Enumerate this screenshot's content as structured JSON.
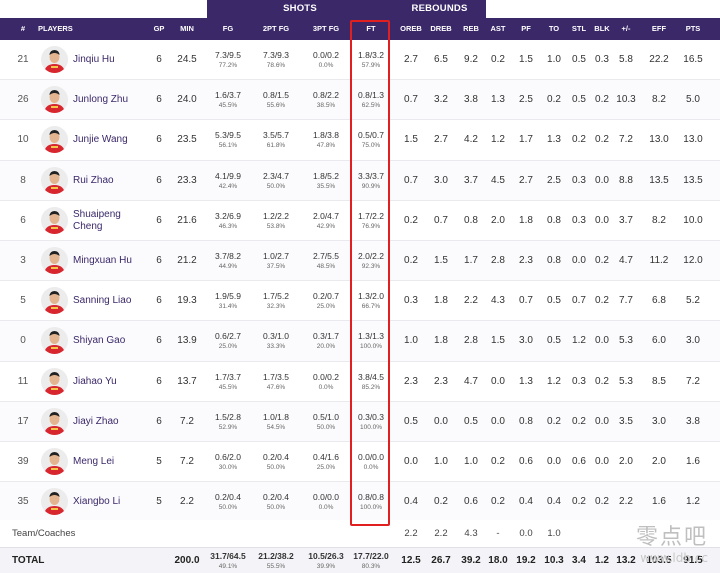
{
  "groups": {
    "shots": "SHOTS",
    "rebounds": "REBOUNDS"
  },
  "columns": [
    "#",
    "PLAYERS",
    "GP",
    "MIN",
    "FG",
    "2PT FG",
    "3PT FG",
    "FT",
    "OREB",
    "DREB",
    "REB",
    "AST",
    "PF",
    "TO",
    "STL",
    "BLK",
    "+/-",
    "EFF",
    "PTS"
  ],
  "players": [
    {
      "num": "21",
      "name": "Jinqiu Hu",
      "gp": "6",
      "min": "24.5",
      "fg": "7.3/9.5",
      "fg_pct": "77.2%",
      "fg2": "7.3/9.3",
      "fg2_pct": "78.6%",
      "fg3": "0.0/0.2",
      "fg3_pct": "0.0%",
      "ft": "1.8/3.2",
      "ft_pct": "57.9%",
      "oreb": "2.7",
      "dreb": "6.5",
      "reb": "9.2",
      "ast": "0.2",
      "pf": "1.5",
      "to": "1.0",
      "stl": "0.5",
      "blk": "0.3",
      "pm": "5.8",
      "eff": "22.2",
      "pts": "16.5"
    },
    {
      "num": "26",
      "name": "Junlong Zhu",
      "gp": "6",
      "min": "24.0",
      "fg": "1.6/3.7",
      "fg_pct": "45.5%",
      "fg2": "0.8/1.5",
      "fg2_pct": "55.6%",
      "fg3": "0.8/2.2",
      "fg3_pct": "38.5%",
      "ft": "0.8/1.3",
      "ft_pct": "62.5%",
      "oreb": "0.7",
      "dreb": "3.2",
      "reb": "3.8",
      "ast": "1.3",
      "pf": "2.5",
      "to": "0.2",
      "stl": "0.5",
      "blk": "0.2",
      "pm": "10.3",
      "eff": "8.2",
      "pts": "5.0"
    },
    {
      "num": "10",
      "name": "Junjie Wang",
      "gp": "6",
      "min": "23.5",
      "fg": "5.3/9.5",
      "fg_pct": "56.1%",
      "fg2": "3.5/5.7",
      "fg2_pct": "61.8%",
      "fg3": "1.8/3.8",
      "fg3_pct": "47.8%",
      "ft": "0.5/0.7",
      "ft_pct": "75.0%",
      "oreb": "1.5",
      "dreb": "2.7",
      "reb": "4.2",
      "ast": "1.2",
      "pf": "1.7",
      "to": "1.3",
      "stl": "0.2",
      "blk": "0.2",
      "pm": "7.2",
      "eff": "13.0",
      "pts": "13.0"
    },
    {
      "num": "8",
      "name": "Rui Zhao",
      "gp": "6",
      "min": "23.3",
      "fg": "4.1/9.9",
      "fg_pct": "42.4%",
      "fg2": "2.3/4.7",
      "fg2_pct": "50.0%",
      "fg3": "1.8/5.2",
      "fg3_pct": "35.5%",
      "ft": "3.3/3.7",
      "ft_pct": "90.9%",
      "oreb": "0.7",
      "dreb": "3.0",
      "reb": "3.7",
      "ast": "4.5",
      "pf": "2.7",
      "to": "2.5",
      "stl": "0.3",
      "blk": "0.0",
      "pm": "8.8",
      "eff": "13.5",
      "pts": "13.5"
    },
    {
      "num": "6",
      "name": "Shuaipeng Cheng",
      "gp": "6",
      "min": "21.6",
      "fg": "3.2/6.9",
      "fg_pct": "46.3%",
      "fg2": "1.2/2.2",
      "fg2_pct": "53.8%",
      "fg3": "2.0/4.7",
      "fg3_pct": "42.9%",
      "ft": "1.7/2.2",
      "ft_pct": "76.9%",
      "oreb": "0.2",
      "dreb": "0.7",
      "reb": "0.8",
      "ast": "2.0",
      "pf": "1.8",
      "to": "0.8",
      "stl": "0.3",
      "blk": "0.0",
      "pm": "3.7",
      "eff": "8.2",
      "pts": "10.0"
    },
    {
      "num": "3",
      "name": "Mingxuan Hu",
      "gp": "6",
      "min": "21.2",
      "fg": "3.7/8.2",
      "fg_pct": "44.9%",
      "fg2": "1.0/2.7",
      "fg2_pct": "37.5%",
      "fg3": "2.7/5.5",
      "fg3_pct": "48.5%",
      "ft": "2.0/2.2",
      "ft_pct": "92.3%",
      "oreb": "0.2",
      "dreb": "1.5",
      "reb": "1.7",
      "ast": "2.8",
      "pf": "2.3",
      "to": "0.8",
      "stl": "0.0",
      "blk": "0.2",
      "pm": "4.7",
      "eff": "11.2",
      "pts": "12.0"
    },
    {
      "num": "5",
      "name": "Sanning Liao",
      "gp": "6",
      "min": "19.3",
      "fg": "1.9/5.9",
      "fg_pct": "31.4%",
      "fg2": "1.7/5.2",
      "fg2_pct": "32.3%",
      "fg3": "0.2/0.7",
      "fg3_pct": "25.0%",
      "ft": "1.3/2.0",
      "ft_pct": "66.7%",
      "oreb": "0.3",
      "dreb": "1.8",
      "reb": "2.2",
      "ast": "4.3",
      "pf": "0.7",
      "to": "0.5",
      "stl": "0.7",
      "blk": "0.2",
      "pm": "7.7",
      "eff": "6.8",
      "pts": "5.2"
    },
    {
      "num": "0",
      "name": "Shiyan Gao",
      "gp": "6",
      "min": "13.9",
      "fg": "0.6/2.7",
      "fg_pct": "25.0%",
      "fg2": "0.3/1.0",
      "fg2_pct": "33.3%",
      "fg3": "0.3/1.7",
      "fg3_pct": "20.0%",
      "ft": "1.3/1.3",
      "ft_pct": "100.0%",
      "oreb": "1.0",
      "dreb": "1.8",
      "reb": "2.8",
      "ast": "1.5",
      "pf": "3.0",
      "to": "0.5",
      "stl": "1.2",
      "blk": "0.0",
      "pm": "5.3",
      "eff": "6.0",
      "pts": "3.0"
    },
    {
      "num": "11",
      "name": "Jiahao Yu",
      "gp": "6",
      "min": "13.7",
      "fg": "1.7/3.7",
      "fg_pct": "45.5%",
      "fg2": "1.7/3.5",
      "fg2_pct": "47.6%",
      "fg3": "0.0/0.2",
      "fg3_pct": "0.0%",
      "ft": "3.8/4.5",
      "ft_pct": "85.2%",
      "oreb": "2.3",
      "dreb": "2.3",
      "reb": "4.7",
      "ast": "0.0",
      "pf": "1.3",
      "to": "1.2",
      "stl": "0.3",
      "blk": "0.2",
      "pm": "5.3",
      "eff": "8.5",
      "pts": "7.2"
    },
    {
      "num": "17",
      "name": "Jiayi Zhao",
      "gp": "6",
      "min": "7.2",
      "fg": "1.5/2.8",
      "fg_pct": "52.9%",
      "fg2": "1.0/1.8",
      "fg2_pct": "54.5%",
      "fg3": "0.5/1.0",
      "fg3_pct": "50.0%",
      "ft": "0.3/0.3",
      "ft_pct": "100.0%",
      "oreb": "0.5",
      "dreb": "0.0",
      "reb": "0.5",
      "ast": "0.0",
      "pf": "0.8",
      "to": "0.2",
      "stl": "0.2",
      "blk": "0.0",
      "pm": "3.5",
      "eff": "3.0",
      "pts": "3.8"
    },
    {
      "num": "39",
      "name": "Meng Lei",
      "gp": "5",
      "min": "7.2",
      "fg": "0.6/2.0",
      "fg_pct": "30.0%",
      "fg2": "0.2/0.4",
      "fg2_pct": "50.0%",
      "fg3": "0.4/1.6",
      "fg3_pct": "25.0%",
      "ft": "0.0/0.0",
      "ft_pct": "0.0%",
      "oreb": "0.0",
      "dreb": "1.0",
      "reb": "1.0",
      "ast": "0.2",
      "pf": "0.6",
      "to": "0.0",
      "stl": "0.6",
      "blk": "0.0",
      "pm": "2.0",
      "eff": "2.0",
      "pts": "1.6"
    },
    {
      "num": "35",
      "name": "Xiangbo Li",
      "gp": "5",
      "min": "2.2",
      "fg": "0.2/0.4",
      "fg_pct": "50.0%",
      "fg2": "0.2/0.4",
      "fg2_pct": "50.0%",
      "fg3": "0.0/0.0",
      "fg3_pct": "0.0%",
      "ft": "0.8/0.8",
      "ft_pct": "100.0%",
      "oreb": "0.4",
      "dreb": "0.2",
      "reb": "0.6",
      "ast": "0.2",
      "pf": "0.4",
      "to": "0.4",
      "stl": "0.2",
      "blk": "0.2",
      "pm": "2.2",
      "eff": "1.6",
      "pts": "1.2"
    }
  ],
  "team": {
    "label": "Team/Coaches",
    "oreb": "2.2",
    "dreb": "2.2",
    "reb": "4.3",
    "ast": "-",
    "pf": "0.0",
    "to": "1.0",
    "stl": "",
    "blk": ""
  },
  "total": {
    "label": "TOTAL",
    "min": "200.0",
    "fg": "31.7/64.5",
    "fg_pct": "49.1%",
    "fg2": "21.2/38.2",
    "fg2_pct": "55.5%",
    "fg3": "10.5/26.3",
    "fg3_pct": "39.9%",
    "ft": "17.7/22.0",
    "ft_pct": "80.3%",
    "oreb": "12.5",
    "dreb": "26.7",
    "reb": "39.2",
    "ast": "18.0",
    "pf": "19.2",
    "to": "10.3",
    "stl": "3.4",
    "blk": "1.2",
    "pm": "13.2",
    "eff": "103.5",
    "pts": "91.5"
  },
  "watermark": {
    "line1": "零点吧",
    "line2": "www.ldb.cc"
  },
  "colors": {
    "header": "#3b2869",
    "highlight": "#e02020",
    "name": "#3b2869"
  }
}
